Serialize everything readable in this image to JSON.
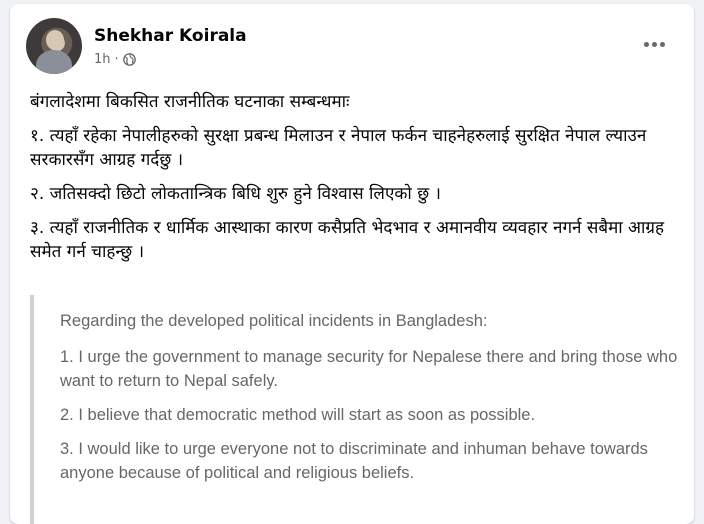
{
  "post": {
    "author": "Shekhar Koirala",
    "time": "1h",
    "separator": "·",
    "privacy_icon": "globe-icon",
    "more_icon": "more-options-icon",
    "nepali_text": [
      "बंगलादेशमा बिकसित राजनीतिक घटनाका सम्बन्धमाः",
      "१. त्यहाँ रहेका नेपालीहरुको सुरक्षा प्रबन्ध मिलाउन र नेपाल फर्कन चाहनेहरुलाई सुरक्षित नेपाल ल्याउन सरकारसँग आग्रह गर्दछु ।",
      "२. जतिसक्दो छिटो लोकतान्त्रिक बिधि शुरु हुने विश्वास लिएको छु ।",
      "३. त्यहाँ राजनीतिक र धार्मिक आस्थाका कारण कसैप्रति भेदभाव र अमानवीय व्यवहार नगर्न सबैमा आग्रह समेत गर्न चाहन्छु ।"
    ],
    "translation": [
      "Regarding the developed political incidents in Bangladesh:",
      "1. I urge the government to manage security for Nepalese there and bring those who want to return to Nepal safely.",
      "2. I believe that democratic method will start as soon as possible.",
      "3. I would like to urge everyone not to discriminate and inhuman behave towards anyone because of political and religious beliefs."
    ]
  }
}
